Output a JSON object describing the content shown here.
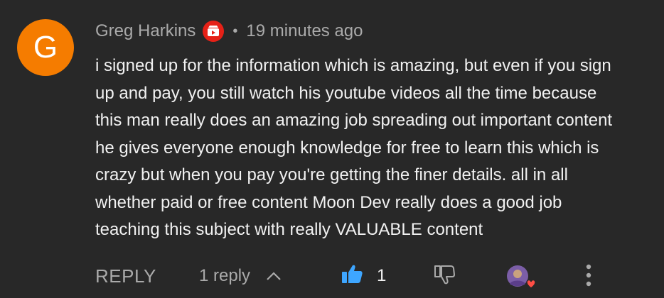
{
  "comment": {
    "avatar_letter": "G",
    "author": "Greg Harkins",
    "separator": "•",
    "time": "19 minutes ago",
    "text": "i signed up for the information which is amazing, but even if you sign\nup and pay, you still watch his youtube videos all the time because\nthis man really does an amazing job spreading out important content\nhe gives everyone enough knowledge for free to learn this which is\ncrazy but when you pay you're getting the finer details. all in all\nwhether paid or free content Moon Dev really does a good job\nteaching this subject with really VALUABLE content"
  },
  "actions": {
    "reply_label": "REPLY",
    "replies_label": "1 reply",
    "like_count": "1"
  },
  "colors": {
    "background": "#282828",
    "avatar": "#f57c00",
    "badge": "#e62117",
    "like_active": "#3ea6ff",
    "heart": "#ff4e45"
  },
  "icons": [
    "membership-badge-icon",
    "chevron-up-icon",
    "thumbs-up-icon",
    "thumbs-down-icon",
    "creator-heart-icon",
    "more-vert-icon"
  ]
}
